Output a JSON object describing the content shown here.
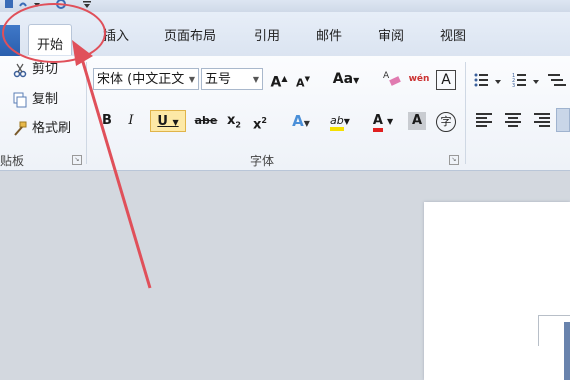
{
  "tabs": [
    "开始",
    "插入",
    "页面布局",
    "引用",
    "邮件",
    "审阅",
    "视图"
  ],
  "clipboard": {
    "cut": "剪切",
    "copy": "复制",
    "format_painter": "格式刷",
    "group_label": "贴板"
  },
  "font": {
    "font_name": "宋体 (中文正文",
    "font_size": "五号",
    "group_label": "字体",
    "grow": "A",
    "shrink": "A",
    "case": "Aa",
    "bold": "B",
    "italic": "I",
    "underline": "U",
    "strike": "abe",
    "subscript": "x",
    "superscript": "x",
    "sub2": "2",
    "sup2": "2",
    "effects": "A",
    "highlight": "ab",
    "font_color": "A",
    "shading": "A",
    "char_border": "A",
    "phonetic": "wén",
    "enclose": "字"
  },
  "annotation": {
    "color": "#e0505a"
  }
}
